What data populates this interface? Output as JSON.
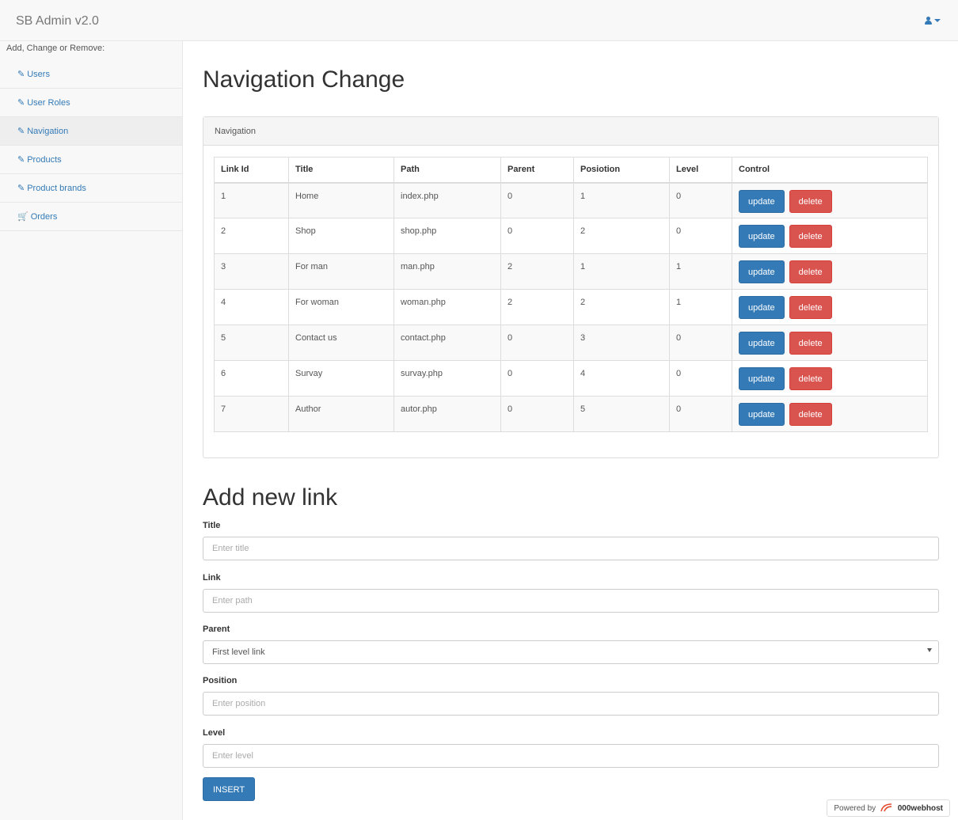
{
  "header": {
    "brand": "SB Admin v2.0"
  },
  "sidebar": {
    "heading": "Add, Change or Remove:",
    "items": [
      {
        "label": "Users",
        "icon": "edit-icon"
      },
      {
        "label": "User Roles",
        "icon": "edit-icon"
      },
      {
        "label": "Navigation",
        "icon": "edit-icon",
        "active": true
      },
      {
        "label": "Products",
        "icon": "edit-icon"
      },
      {
        "label": "Product brands",
        "icon": "edit-icon"
      },
      {
        "label": "Orders",
        "icon": "shopping-cart-icon"
      }
    ]
  },
  "main": {
    "title": "Navigation Change",
    "panel_title": "Navigation",
    "table": {
      "columns": [
        "Link Id",
        "Title",
        "Path",
        "Parent",
        "Posiotion",
        "Level",
        "Control"
      ],
      "rows": [
        [
          "1",
          "Home",
          "index.php",
          "0",
          "1",
          "0"
        ],
        [
          "2",
          "Shop",
          "shop.php",
          "0",
          "2",
          "0"
        ],
        [
          "3",
          "For man",
          "man.php",
          "2",
          "1",
          "1"
        ],
        [
          "4",
          "For woman",
          "woman.php",
          "2",
          "2",
          "1"
        ],
        [
          "5",
          "Contact us",
          "contact.php",
          "0",
          "3",
          "0"
        ],
        [
          "6",
          "Survay",
          "survay.php",
          "0",
          "4",
          "0"
        ],
        [
          "7",
          "Author",
          "autor.php",
          "0",
          "5",
          "0"
        ]
      ],
      "update_label": "update",
      "delete_label": "delete"
    }
  },
  "form": {
    "title": "Add new link",
    "title_label": "Title",
    "title_placeholder": "Enter title",
    "link_label": "Link",
    "link_placeholder": "Enter path",
    "parent_label": "Parent",
    "parent_selected": "First level link",
    "position_label": "Position",
    "position_placeholder": "Enter position",
    "level_label": "Level",
    "level_placeholder": "Enter level",
    "insert_label": "INSERT"
  },
  "footer": {
    "powered_by": "Powered by",
    "host": "000webhost"
  },
  "colors": {
    "primary": "#337ab7",
    "danger": "#d9534f",
    "host_logo": "#e64a2e"
  }
}
